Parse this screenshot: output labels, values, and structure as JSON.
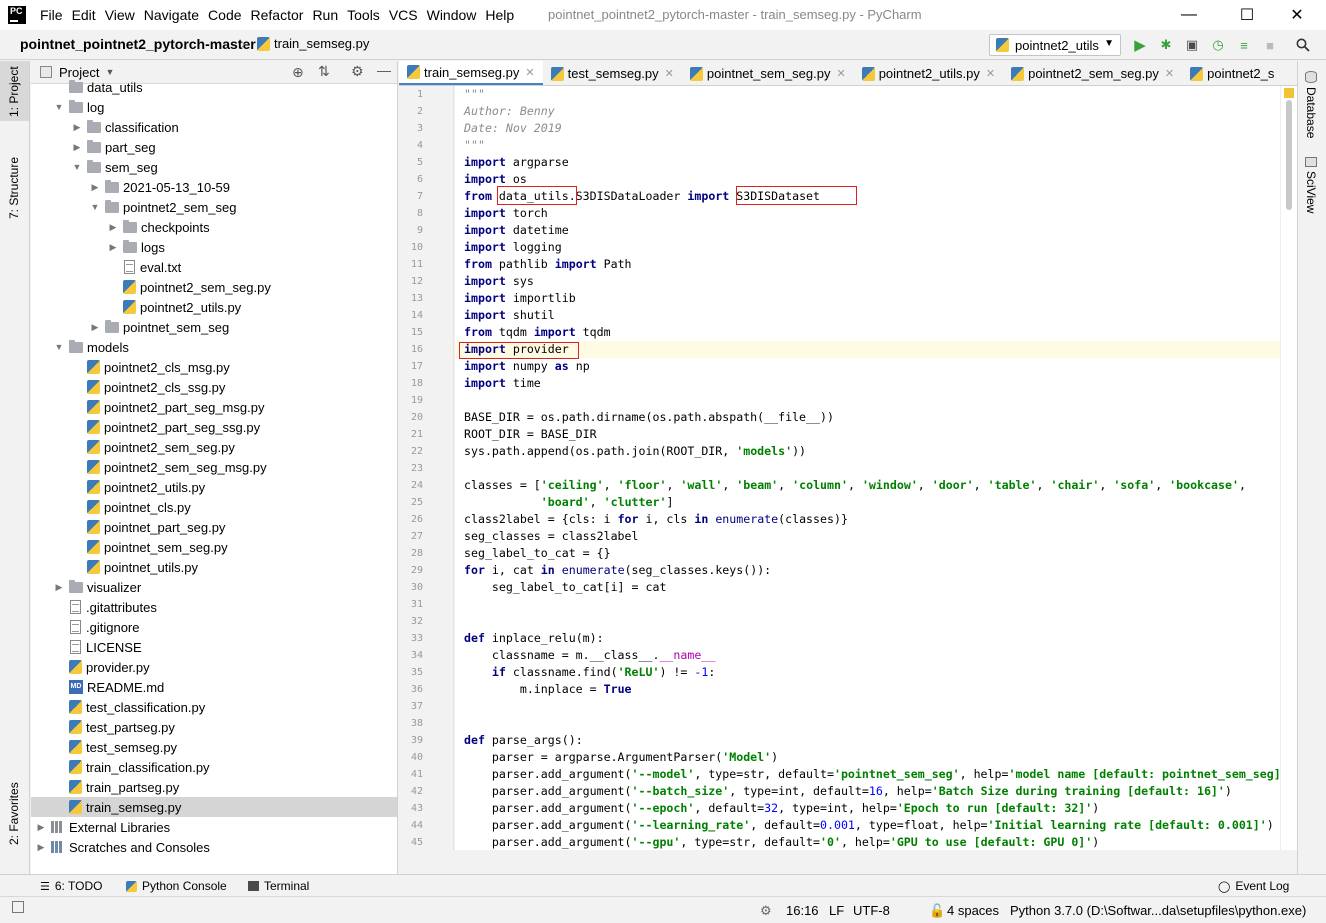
{
  "window": {
    "title": "pointnet_pointnet2_pytorch-master - train_semseg.py - PyCharm",
    "logo": "PC",
    "menu": [
      "File",
      "Edit",
      "View",
      "Navigate",
      "Code",
      "Refactor",
      "Run",
      "Tools",
      "VCS",
      "Window",
      "Help"
    ]
  },
  "navbar": {
    "project": "pointnet_pointnet2_pytorch-master",
    "file": "train_semseg.py",
    "run_config": "pointnet2_utils"
  },
  "left_strip": {
    "project_tab": "1: Project",
    "structure_tab": "7: Structure",
    "favorites_tab": "2: Favorites"
  },
  "project_panel": {
    "title": "Project",
    "tree": [
      {
        "label": "data_utils",
        "type": "folder",
        "depth": 1,
        "arrow": ""
      },
      {
        "label": "log",
        "type": "folder",
        "depth": 1,
        "arrow": "open"
      },
      {
        "label": "classification",
        "type": "folder",
        "depth": 2,
        "arrow": "closed"
      },
      {
        "label": "part_seg",
        "type": "folder",
        "depth": 2,
        "arrow": "closed"
      },
      {
        "label": "sem_seg",
        "type": "folder",
        "depth": 2,
        "arrow": "open"
      },
      {
        "label": "2021-05-13_10-59",
        "type": "folder",
        "depth": 3,
        "arrow": "closed"
      },
      {
        "label": "pointnet2_sem_seg",
        "type": "folder",
        "depth": 3,
        "arrow": "open"
      },
      {
        "label": "checkpoints",
        "type": "folder",
        "depth": 4,
        "arrow": "closed"
      },
      {
        "label": "logs",
        "type": "folder",
        "depth": 4,
        "arrow": "closed"
      },
      {
        "label": "eval.txt",
        "type": "txt",
        "depth": 4,
        "arrow": ""
      },
      {
        "label": "pointnet2_sem_seg.py",
        "type": "py",
        "depth": 4,
        "arrow": ""
      },
      {
        "label": "pointnet2_utils.py",
        "type": "py",
        "depth": 4,
        "arrow": ""
      },
      {
        "label": "pointnet_sem_seg",
        "type": "folder",
        "depth": 3,
        "arrow": "closed"
      },
      {
        "label": "models",
        "type": "folder",
        "depth": 1,
        "arrow": "open"
      },
      {
        "label": "pointnet2_cls_msg.py",
        "type": "py",
        "depth": 2,
        "arrow": ""
      },
      {
        "label": "pointnet2_cls_ssg.py",
        "type": "py",
        "depth": 2,
        "arrow": ""
      },
      {
        "label": "pointnet2_part_seg_msg.py",
        "type": "py",
        "depth": 2,
        "arrow": ""
      },
      {
        "label": "pointnet2_part_seg_ssg.py",
        "type": "py",
        "depth": 2,
        "arrow": ""
      },
      {
        "label": "pointnet2_sem_seg.py",
        "type": "py",
        "depth": 2,
        "arrow": ""
      },
      {
        "label": "pointnet2_sem_seg_msg.py",
        "type": "py",
        "depth": 2,
        "arrow": ""
      },
      {
        "label": "pointnet2_utils.py",
        "type": "py",
        "depth": 2,
        "arrow": ""
      },
      {
        "label": "pointnet_cls.py",
        "type": "py",
        "depth": 2,
        "arrow": ""
      },
      {
        "label": "pointnet_part_seg.py",
        "type": "py",
        "depth": 2,
        "arrow": ""
      },
      {
        "label": "pointnet_sem_seg.py",
        "type": "py",
        "depth": 2,
        "arrow": ""
      },
      {
        "label": "pointnet_utils.py",
        "type": "py",
        "depth": 2,
        "arrow": ""
      },
      {
        "label": "visualizer",
        "type": "folder",
        "depth": 1,
        "arrow": "closed"
      },
      {
        "label": ".gitattributes",
        "type": "txt",
        "depth": 1,
        "arrow": ""
      },
      {
        "label": ".gitignore",
        "type": "txt",
        "depth": 1,
        "arrow": ""
      },
      {
        "label": "LICENSE",
        "type": "txt",
        "depth": 1,
        "arrow": ""
      },
      {
        "label": "provider.py",
        "type": "py",
        "depth": 1,
        "arrow": ""
      },
      {
        "label": "README.md",
        "type": "md",
        "depth": 1,
        "arrow": ""
      },
      {
        "label": "test_classification.py",
        "type": "py",
        "depth": 1,
        "arrow": ""
      },
      {
        "label": "test_partseg.py",
        "type": "py",
        "depth": 1,
        "arrow": ""
      },
      {
        "label": "test_semseg.py",
        "type": "py",
        "depth": 1,
        "arrow": ""
      },
      {
        "label": "train_classification.py",
        "type": "py",
        "depth": 1,
        "arrow": ""
      },
      {
        "label": "train_partseg.py",
        "type": "py",
        "depth": 1,
        "arrow": ""
      },
      {
        "label": "train_semseg.py",
        "type": "py",
        "depth": 1,
        "arrow": "",
        "selected": true
      },
      {
        "label": "External Libraries",
        "type": "lib",
        "depth": 0,
        "arrow": "closed"
      },
      {
        "label": "Scratches and Consoles",
        "type": "scratch",
        "depth": 0,
        "arrow": "closed"
      }
    ]
  },
  "editor_tabs": [
    {
      "label": "train_semseg.py",
      "active": true
    },
    {
      "label": "test_semseg.py",
      "active": false
    },
    {
      "label": "pointnet_sem_seg.py",
      "active": false
    },
    {
      "label": "pointnet2_utils.py",
      "active": false
    },
    {
      "label": "pointnet2_sem_seg.py",
      "active": false
    },
    {
      "label": "pointnet2_s",
      "active": false
    }
  ],
  "code": {
    "current_line": 16,
    "lines": [
      {
        "n": "1",
        "tokens": [
          [
            "com",
            "\"\"\""
          ]
        ]
      },
      {
        "n": "2",
        "tokens": [
          [
            "com",
            "Author: Benny"
          ]
        ]
      },
      {
        "n": "3",
        "tokens": [
          [
            "com",
            "Date: Nov 2019"
          ]
        ]
      },
      {
        "n": "4",
        "tokens": [
          [
            "com",
            "\"\"\""
          ]
        ]
      },
      {
        "n": "5",
        "tokens": [
          [
            "kw",
            "import"
          ],
          [
            "",
            " argparse"
          ]
        ]
      },
      {
        "n": "6",
        "tokens": [
          [
            "kw",
            "import"
          ],
          [
            "",
            " os"
          ]
        ]
      },
      {
        "n": "7",
        "tokens": [
          [
            "kw",
            "from"
          ],
          [
            "",
            " data_utils.S3DISDataLoader "
          ],
          [
            "kw",
            "import"
          ],
          [
            "",
            " S3DISDataset"
          ]
        ]
      },
      {
        "n": "8",
        "tokens": [
          [
            "kw",
            "import"
          ],
          [
            "",
            " torch"
          ]
        ]
      },
      {
        "n": "9",
        "tokens": [
          [
            "kw",
            "import"
          ],
          [
            "",
            " datetime"
          ]
        ]
      },
      {
        "n": "10",
        "tokens": [
          [
            "kw",
            "import"
          ],
          [
            "",
            " logging"
          ]
        ]
      },
      {
        "n": "11",
        "tokens": [
          [
            "kw",
            "from"
          ],
          [
            "",
            " pathlib "
          ],
          [
            "kw",
            "import"
          ],
          [
            "",
            " Path"
          ]
        ]
      },
      {
        "n": "12",
        "tokens": [
          [
            "kw",
            "import"
          ],
          [
            "",
            " sys"
          ]
        ]
      },
      {
        "n": "13",
        "tokens": [
          [
            "kw",
            "import"
          ],
          [
            "",
            " importlib"
          ]
        ]
      },
      {
        "n": "14",
        "tokens": [
          [
            "kw",
            "import"
          ],
          [
            "",
            " shutil"
          ]
        ]
      },
      {
        "n": "15",
        "tokens": [
          [
            "kw",
            "from"
          ],
          [
            "",
            " tqdm "
          ],
          [
            "kw",
            "import"
          ],
          [
            "",
            " tqdm"
          ]
        ]
      },
      {
        "n": "16",
        "tokens": [
          [
            "kw",
            "import"
          ],
          [
            "",
            " provider"
          ]
        ]
      },
      {
        "n": "17",
        "tokens": [
          [
            "kw",
            "import"
          ],
          [
            "",
            " numpy "
          ],
          [
            "kw",
            "as"
          ],
          [
            "",
            " np"
          ]
        ]
      },
      {
        "n": "18",
        "tokens": [
          [
            "kw",
            "import"
          ],
          [
            "",
            " time"
          ]
        ]
      },
      {
        "n": "19",
        "tokens": []
      },
      {
        "n": "20",
        "tokens": [
          [
            "",
            "BASE_DIR = os.path.dirname(os.path.abspath(__file__))"
          ]
        ]
      },
      {
        "n": "21",
        "tokens": [
          [
            "",
            "ROOT_DIR = BASE_DIR"
          ]
        ]
      },
      {
        "n": "22",
        "tokens": [
          [
            "",
            "sys.path.append(os.path.join(ROOT_DIR, "
          ],
          [
            "str",
            "'models'"
          ],
          [
            "",
            "))"
          ]
        ]
      },
      {
        "n": "23",
        "tokens": []
      },
      {
        "n": "24",
        "tokens": [
          [
            "",
            "classes = ["
          ],
          [
            "str",
            "'ceiling'"
          ],
          [
            "",
            ", "
          ],
          [
            "str",
            "'floor'"
          ],
          [
            "",
            ", "
          ],
          [
            "str",
            "'wall'"
          ],
          [
            "",
            ", "
          ],
          [
            "str",
            "'beam'"
          ],
          [
            "",
            ", "
          ],
          [
            "str",
            "'column'"
          ],
          [
            "",
            ", "
          ],
          [
            "str",
            "'window'"
          ],
          [
            "",
            ", "
          ],
          [
            "str",
            "'door'"
          ],
          [
            "",
            ", "
          ],
          [
            "str",
            "'table'"
          ],
          [
            "",
            ", "
          ],
          [
            "str",
            "'chair'"
          ],
          [
            "",
            ", "
          ],
          [
            "str",
            "'sofa'"
          ],
          [
            "",
            ", "
          ],
          [
            "str",
            "'bookcase'"
          ],
          [
            "",
            ","
          ]
        ]
      },
      {
        "n": "25",
        "tokens": [
          [
            "",
            "           "
          ],
          [
            "str",
            "'board'"
          ],
          [
            "",
            ", "
          ],
          [
            "str",
            "'clutter'"
          ],
          [
            "",
            "]"
          ]
        ]
      },
      {
        "n": "26",
        "tokens": [
          [
            "",
            "class2label = {cls: i "
          ],
          [
            "kw",
            "for"
          ],
          [
            "",
            " i, cls "
          ],
          [
            "kw",
            "in"
          ],
          [
            "",
            " "
          ],
          [
            "builtin",
            "enumerate"
          ],
          [
            "",
            "(classes)}"
          ]
        ]
      },
      {
        "n": "27",
        "tokens": [
          [
            "",
            "seg_classes = class2label"
          ]
        ]
      },
      {
        "n": "28",
        "tokens": [
          [
            "",
            "seg_label_to_cat = {}"
          ]
        ]
      },
      {
        "n": "29",
        "tokens": [
          [
            "kw",
            "for"
          ],
          [
            "",
            " i, cat "
          ],
          [
            "kw",
            "in"
          ],
          [
            "",
            " "
          ],
          [
            "builtin",
            "enumerate"
          ],
          [
            "",
            "(seg_classes.keys()):"
          ]
        ]
      },
      {
        "n": "30",
        "tokens": [
          [
            "",
            "    seg_label_to_cat[i] = cat"
          ]
        ]
      },
      {
        "n": "31",
        "tokens": []
      },
      {
        "n": "32",
        "tokens": []
      },
      {
        "n": "33",
        "tokens": [
          [
            "kw",
            "def"
          ],
          [
            "",
            " inplace_relu(m):"
          ]
        ]
      },
      {
        "n": "34",
        "tokens": [
          [
            "",
            "    classname = m.__class__."
          ],
          [
            "magic",
            "__name__"
          ]
        ]
      },
      {
        "n": "35",
        "tokens": [
          [
            "",
            "    "
          ],
          [
            "kw",
            "if"
          ],
          [
            "",
            " classname.find("
          ],
          [
            "str",
            "'ReLU'"
          ],
          [
            "",
            ") != "
          ],
          [
            "num",
            "-1"
          ],
          [
            "",
            ":"
          ]
        ]
      },
      {
        "n": "36",
        "tokens": [
          [
            "",
            "        m.inplace = "
          ],
          [
            "kw",
            "True"
          ]
        ]
      },
      {
        "n": "37",
        "tokens": []
      },
      {
        "n": "38",
        "tokens": []
      },
      {
        "n": "39",
        "tokens": [
          [
            "kw",
            "def"
          ],
          [
            "",
            " parse_args():"
          ]
        ]
      },
      {
        "n": "40",
        "tokens": [
          [
            "",
            "    parser = argparse.ArgumentParser("
          ],
          [
            "str",
            "'Model'"
          ],
          [
            "",
            ")"
          ]
        ]
      },
      {
        "n": "41",
        "tokens": [
          [
            "",
            "    parser.add_argument("
          ],
          [
            "str",
            "'--model'"
          ],
          [
            "",
            ", type=str, default="
          ],
          [
            "str",
            "'pointnet_sem_seg'"
          ],
          [
            "",
            ", help="
          ],
          [
            "str",
            "'model name [default: pointnet_sem_seg]'"
          ],
          [
            "",
            ")"
          ]
        ]
      },
      {
        "n": "42",
        "tokens": [
          [
            "",
            "    parser.add_argument("
          ],
          [
            "str",
            "'--batch_size'"
          ],
          [
            "",
            ", type=int, default="
          ],
          [
            "num",
            "16"
          ],
          [
            "",
            ", help="
          ],
          [
            "str",
            "'Batch Size during training [default: 16]'"
          ],
          [
            "",
            ")"
          ]
        ]
      },
      {
        "n": "43",
        "tokens": [
          [
            "",
            "    parser.add_argument("
          ],
          [
            "str",
            "'--epoch'"
          ],
          [
            "",
            ", default="
          ],
          [
            "num",
            "32"
          ],
          [
            "",
            ", type=int, help="
          ],
          [
            "str",
            "'Epoch to run [default: 32]'"
          ],
          [
            "",
            ")"
          ]
        ]
      },
      {
        "n": "44",
        "tokens": [
          [
            "",
            "    parser.add_argument("
          ],
          [
            "str",
            "'--learning_rate'"
          ],
          [
            "",
            ", default="
          ],
          [
            "num",
            "0.001"
          ],
          [
            "",
            ", type=float, help="
          ],
          [
            "str",
            "'Initial learning rate [default: 0.001]'"
          ],
          [
            "",
            ")"
          ]
        ]
      },
      {
        "n": "45",
        "tokens": [
          [
            "",
            "    parser.add_argument("
          ],
          [
            "str",
            "'--gpu'"
          ],
          [
            "",
            ", type=str, default="
          ],
          [
            "str",
            "'0'"
          ],
          [
            "",
            ", help="
          ],
          [
            "str",
            "'GPU to use [default: GPU 0]'"
          ],
          [
            "",
            ")"
          ]
        ]
      }
    ]
  },
  "right_strip": {
    "database_tab": "Database",
    "sciview_tab": "SciView"
  },
  "bottom_tools": {
    "todo": "6: TODO",
    "python_console": "Python Console",
    "terminal": "Terminal",
    "event_log": "Event Log"
  },
  "status": {
    "position": "16:16",
    "line_sep": "LF",
    "encoding": "UTF-8",
    "indent": "4 spaces",
    "interpreter": "Python 3.7.0 (D:\\Softwar...da\\setupfiles\\python.exe)"
  }
}
